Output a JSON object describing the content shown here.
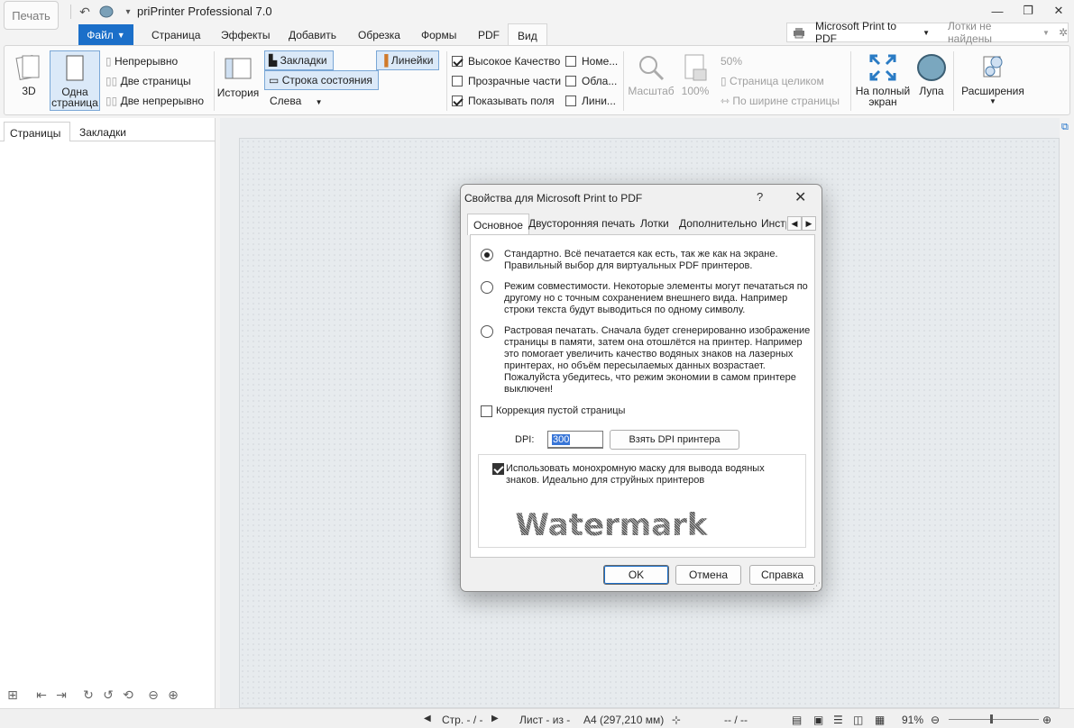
{
  "app": {
    "title": "priPrinter Professional 7.0",
    "print_button": "Печать"
  },
  "menu": {
    "file": "Файл",
    "items": [
      "Страница",
      "Эффекты",
      "Добавить",
      "Обрезка",
      "Формы",
      "PDF",
      "Вид"
    ],
    "active": "Вид"
  },
  "printer": {
    "name": "Microsoft Print to PDF",
    "trays": "Лотки не найдены"
  },
  "ribbon": {
    "view_3d": "3D",
    "one_page_line1": "Одна",
    "one_page_line2": "страница",
    "continuous": "Непрерывно",
    "two_pages": "Две страницы",
    "two_continuous": "Две непрерывно",
    "history": "История",
    "bookmarks": "Закладки",
    "status_bar": "Строка состояния",
    "left": "Слева",
    "rulers": "Линейки",
    "high_quality": "Высокое Качество",
    "transparent_parts": "Прозрачные части",
    "show_margins": "Показывать поля",
    "numbers": "Номе...",
    "areas": "Обла...",
    "lines": "Лини...",
    "scale": "Масштаб",
    "percent_100": "100%",
    "percent_50": "50%",
    "whole_page": "Страница целиком",
    "page_width": "По ширине страницы",
    "fullscreen_line1": "На полный",
    "fullscreen_line2": "экран",
    "magnifier": "Лупа",
    "extensions": "Расширения"
  },
  "left_panel": {
    "tabs": [
      "Страницы",
      "Закладки"
    ]
  },
  "status": {
    "page": "Стр. - / -",
    "sheet": "Лист - из -",
    "paper": "A4 (297,210 мм)",
    "pos": "-- / --",
    "zoom": "91%"
  },
  "dialog": {
    "title": "Свойства для Microsoft Print to PDF",
    "help": "?",
    "tabs": [
      "Основное",
      "Двусторонняя печать",
      "Лотки",
      "Дополнительно",
      "Инстр"
    ],
    "options": [
      {
        "text": "Стандартно. Всё печатается как есть, так же как на экране. Правильный выбор для виртуальных PDF принтеров.",
        "selected": true
      },
      {
        "text": "Режим совместимости. Некоторые элементы могут печататься по другому но с точным сохранением внешнего вида. Например строки текста будут выводиться по одному символу.",
        "selected": false
      },
      {
        "text": "Растровая печатать. Сначала будет сгенерированно изображение страницы в памяти, затем она отошлётся на принтер. Например это помогает увеличить качество водяных знаков на лазерных принтерах, но объём пересылаемых данных возрастает. Пожалуйста убедитесь, что режим экономии в самом принтере выключен!",
        "selected": false
      }
    ],
    "empty_page_fix": "Коррекция пустой страницы",
    "dpi_label": "DPI:",
    "dpi_value": "300",
    "get_dpi_button": "Взять DPI принтера",
    "mono_mask": "Использовать монохромную маску для вывода водяных знаков. Идеально для струйных принтеров",
    "watermark_sample": "Watermark",
    "ok": "OK",
    "cancel": "Отмена",
    "help_button": "Справка"
  }
}
